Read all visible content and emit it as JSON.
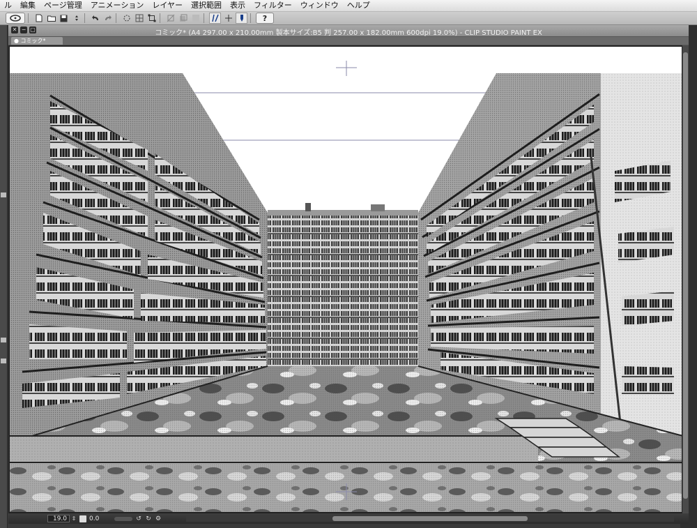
{
  "menubar": {
    "items": [
      "ル",
      "編集",
      "ページ管理",
      "アニメーション",
      "レイヤー",
      "選択範囲",
      "表示",
      "フィルター",
      "ウィンドウ",
      "ヘルプ"
    ]
  },
  "toolbar": {
    "icons": [
      "app-logo-icon",
      "new-file-icon",
      "open-folder-icon",
      "save-icon",
      "undo-icon",
      "redo-icon",
      "transform-icon",
      "select-icon",
      "ruler-icon",
      "pen-icon",
      "help-icon"
    ],
    "help_label": "?"
  },
  "document": {
    "title": "コミック* (A4 297.00 x 210.00mm 製本サイズ:B5 判 257.00 x 182.00mm 600dpi 19.0%)  - CLIP STUDIO PAINT EX",
    "tab_label": "コミック*"
  },
  "status": {
    "zoom": "19.0",
    "angle": "0.0"
  }
}
